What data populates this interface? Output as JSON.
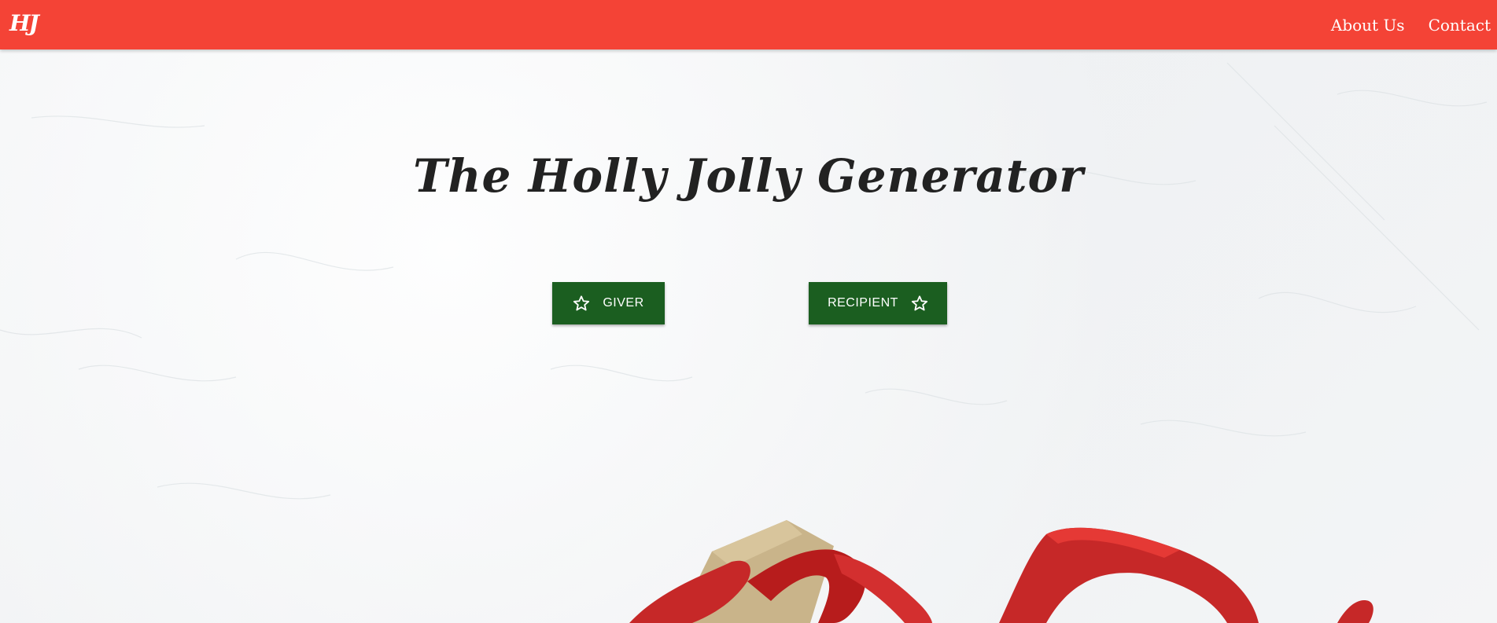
{
  "navbar": {
    "logo": "HJ",
    "links": [
      {
        "label": "About Us"
      },
      {
        "label": "Contact"
      }
    ]
  },
  "hero": {
    "title": "The Holly Jolly Generator"
  },
  "buttons": {
    "giver": {
      "label": "GIVER",
      "icon": "star-outline-icon"
    },
    "recipient": {
      "label": "RECIPIENT",
      "icon": "star-outline-icon"
    }
  },
  "colors": {
    "navbar": "#f44336",
    "button": "#1b5e20",
    "title": "#222222",
    "ribbon": "#c62828"
  }
}
